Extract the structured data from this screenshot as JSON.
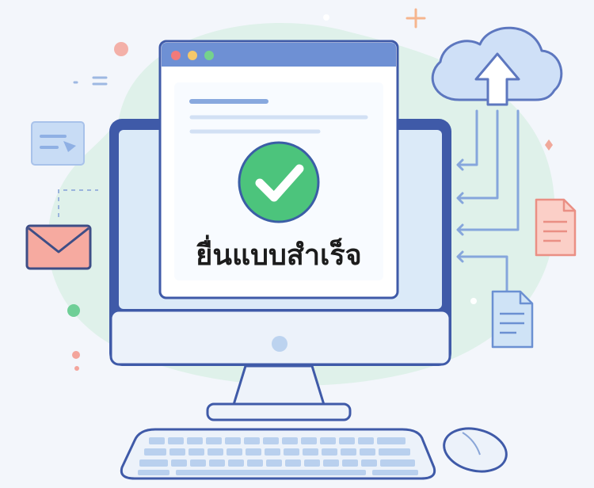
{
  "dialog": {
    "status_text": "ยื่นแบบสำเร็จ",
    "status_icon": "checkmark-icon"
  },
  "window_controls": [
    "close",
    "minimize",
    "maximize"
  ],
  "icons": {
    "upload": "cloud-upload-icon",
    "mail": "envelope-icon",
    "chat": "chat-bubble-icon",
    "document_red": "document-icon",
    "document_blue": "document-icon"
  },
  "colors": {
    "success": "#4cc47c",
    "window_bar": "#6e90d4",
    "frame": "#3f5aa8",
    "screen": "#dbeaf8",
    "envelope": "#f6aaa0",
    "doc_red": "#fbcfc7",
    "doc_blue": "#cfe3f6",
    "cloud": "#cfe0f7",
    "glow": "#d8efe4"
  }
}
